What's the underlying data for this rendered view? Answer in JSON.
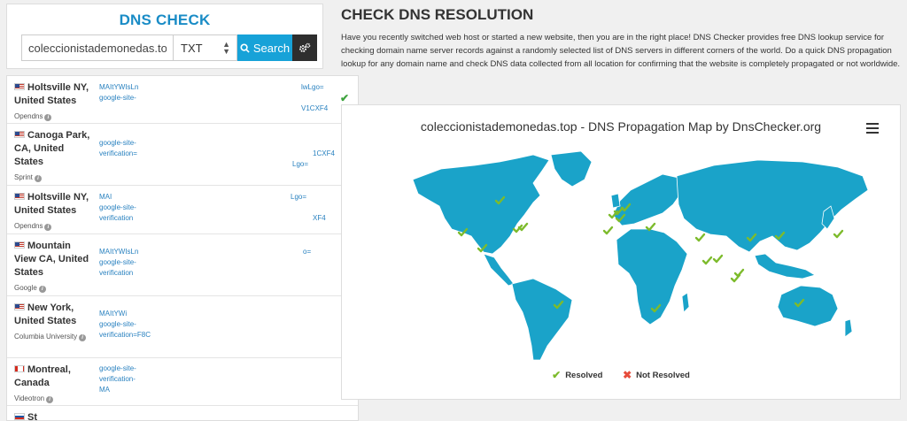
{
  "dns_check": {
    "title": "DNS CHECK",
    "domain_value": "coleccionistademonedas.top",
    "record_type": "TXT",
    "search_label": "Search"
  },
  "results": [
    {
      "location": "Holtsville NY, United States",
      "isp": "Opendns",
      "flag": "us",
      "lines": [
        "MAItYWIsLn",
        "google-site-"
      ],
      "tails": [
        "lwLgo=",
        "V1CXF4"
      ]
    },
    {
      "location": "Canoga Park, CA, United States",
      "isp": "Sprint",
      "flag": "us",
      "lines": [
        "google-site-",
        "verification="
      ],
      "tails": [
        "1CXF4",
        "Lgo="
      ]
    },
    {
      "location": "Holtsville NY, United States",
      "isp": "Opendns",
      "flag": "us",
      "lines": [
        "MAI",
        "google-site-",
        "verification"
      ],
      "tails": [
        "Lgo=",
        "XF4"
      ]
    },
    {
      "location": "Mountain View CA, United States",
      "isp": "Google",
      "flag": "us",
      "lines": [
        "MAItYWIsLn",
        "google-site-",
        "verification"
      ],
      "tails": [
        "o="
      ]
    },
    {
      "location": "New York, United States",
      "isp": "Columbia University",
      "flag": "us",
      "lines": [
        "MAItYWi",
        "google-site-",
        "verification=F8C"
      ],
      "tails": []
    },
    {
      "location": "Montreal, Canada",
      "isp": "Videotron",
      "flag": "ca",
      "lines": [
        "google-site-",
        "verification-",
        "MA"
      ],
      "tails": []
    },
    {
      "location": "St",
      "isp": "",
      "flag": "ru",
      "lines": [],
      "tails": []
    }
  ],
  "main": {
    "title": "CHECK DNS RESOLUTION",
    "description": "Have you recently switched web host or started a new website, then you are in the right place! DNS Checker provides free DNS lookup service for checking domain name server records against a randomly selected list of DNS servers in different corners of the world. Do a quick DNS propagation lookup for any domain name and check DNS data collected from all location for confirming that the website is completely propagated or not worldwide."
  },
  "map": {
    "title": "coleccionistademonedas.top - DNS Propagation Map by DnsChecker.org",
    "legend_resolved": "Resolved",
    "legend_not_resolved": "Not Resolved",
    "land_color": "#1aa3c9",
    "resolved_color": "#7dbb2c",
    "not_resolved_color": "#e74c3c"
  }
}
